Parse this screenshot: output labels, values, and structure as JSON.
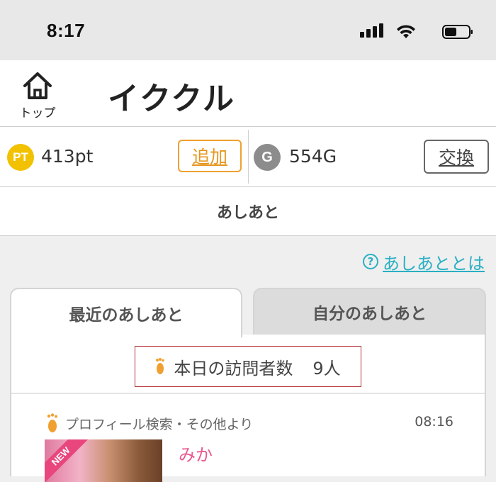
{
  "status_bar": {
    "time": "8:17",
    "icons": [
      "signal-icon",
      "wifi-icon",
      "battery-icon"
    ]
  },
  "header": {
    "home_label": "トップ",
    "title": "イククル"
  },
  "points": {
    "pt_badge": "PT",
    "pt_value": "413pt",
    "add_label": "追加",
    "g_badge": "G",
    "g_value": "554G",
    "exchange_label": "交換"
  },
  "section": {
    "title": "あしあと",
    "help_icon": "?",
    "help_link": "あしあととは"
  },
  "tabs": [
    {
      "label": "最近のあしあと",
      "active": true
    },
    {
      "label": "自分のあしあと",
      "active": false
    }
  ],
  "visitors": {
    "label": "本日の訪問者数",
    "count": "9人"
  },
  "entries": [
    {
      "source": "プロフィール検索・その他より",
      "time": "08:16",
      "badge": "NEW",
      "name": "みか"
    }
  ],
  "colors": {
    "accent_orange": "#f0a030",
    "pt_yellow": "#f2c100",
    "link_cyan": "#2ab0c4",
    "name_pink": "#e8588f",
    "highlight_red": "#b5323a"
  }
}
